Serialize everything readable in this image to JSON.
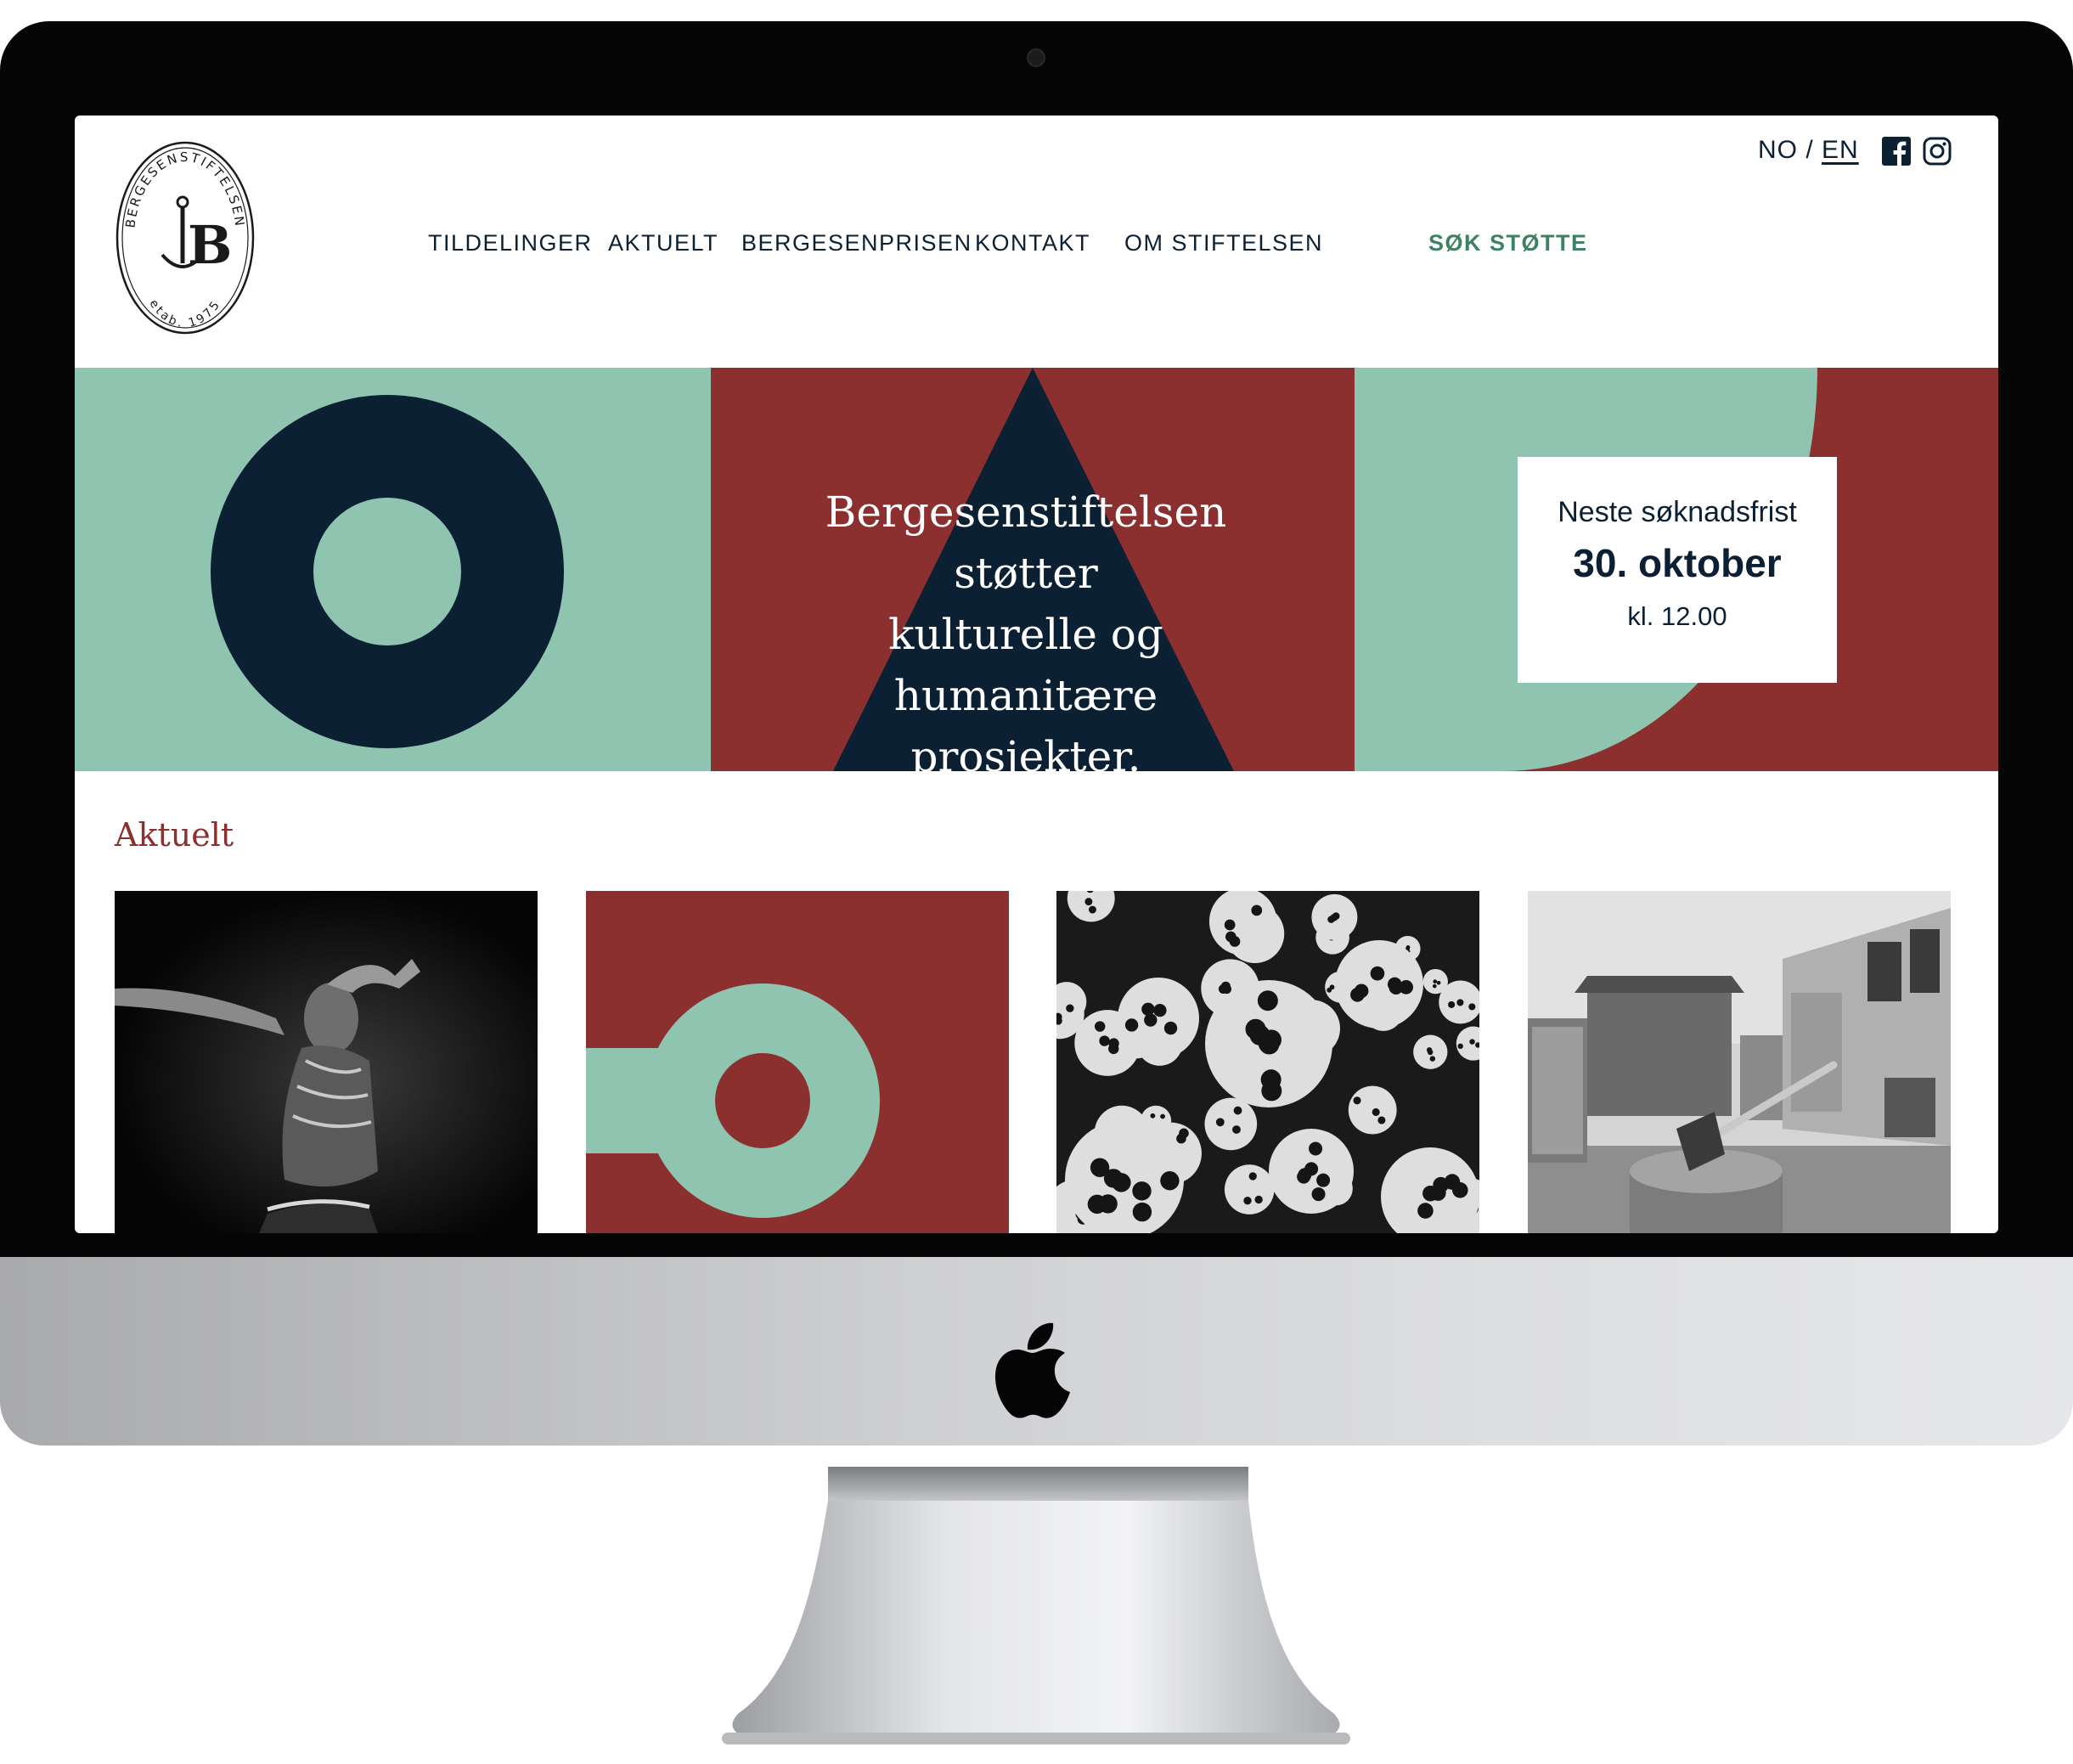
{
  "header": {
    "lang": {
      "no": "NO",
      "sep": " / ",
      "en": "EN"
    },
    "social": [
      {
        "icon": "facebook-icon"
      },
      {
        "icon": "instagram-icon"
      }
    ],
    "nav": [
      {
        "label": "TILDELINGER"
      },
      {
        "label": "AKTUELT"
      },
      {
        "label": "BERGESENPRISEN"
      },
      {
        "label": "KONTAKT"
      },
      {
        "label": "OM STIFTELSEN"
      }
    ],
    "cta": "SØK STØTTE"
  },
  "logo": {
    "ring_text": "BERGESENSTIFTELSEN",
    "monogram": "B",
    "est": "etab. 1975"
  },
  "hero": {
    "tagline_lines": [
      "Bergesenstiftelsen støtter",
      "kulturelle og humanitære",
      "prosjekter."
    ],
    "deadline": {
      "label": "Neste søknadsfrist",
      "date": "30. oktober",
      "time": "kl. 12.00"
    }
  },
  "news": {
    "title": "Aktuelt",
    "cards": [
      {
        "kind": "photo-dancer"
      },
      {
        "kind": "graphic-ring"
      },
      {
        "kind": "photo-lanterns"
      },
      {
        "kind": "photo-axe"
      }
    ]
  },
  "colors": {
    "navy": "#0c2033",
    "teal": "#8fc4b0",
    "red": "#8b2f2f",
    "green": "#3e8263"
  }
}
